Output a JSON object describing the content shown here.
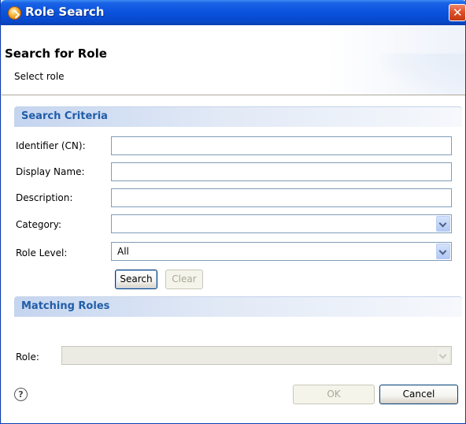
{
  "window": {
    "title": "Role Search"
  },
  "header": {
    "title": "Search for Role",
    "subtitle": "Select role"
  },
  "criteria": {
    "heading": "Search Criteria",
    "identifier_label": "Identifier (CN):",
    "identifier_value": "",
    "display_name_label": "Display Name:",
    "display_name_value": "",
    "description_label": "Description:",
    "description_value": "",
    "category_label": "Category:",
    "category_value": "",
    "role_level_label": "Role Level:",
    "role_level_value": "All",
    "search_label": "Search",
    "clear_label": "Clear"
  },
  "matching": {
    "heading": "Matching Roles",
    "role_label": "Role:",
    "role_value": ""
  },
  "footer": {
    "help_glyph": "?",
    "ok_label": "OK",
    "cancel_label": "Cancel"
  },
  "colors": {
    "title_bar": "#0a52dc",
    "section_heading_text": "#215da8",
    "close_button": "#e0502a"
  }
}
